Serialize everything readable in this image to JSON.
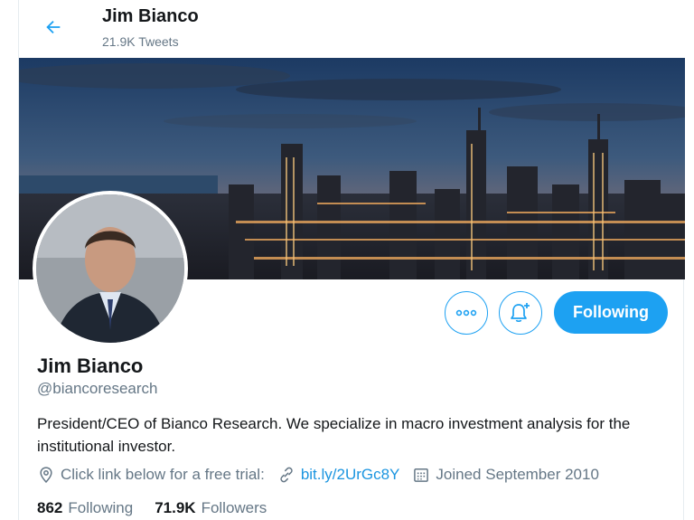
{
  "header": {
    "name": "Jim Bianco",
    "tweet_count": "21.9K Tweets"
  },
  "profile": {
    "display_name": "Jim Bianco",
    "handle": "@biancoresearch",
    "bio": "President/CEO of Bianco Research. We specialize in macro investment analysis for the institutional investor.",
    "location": "Click link below for a free trial:",
    "link": "bit.ly/2UrGc8Y",
    "joined": "Joined September 2010",
    "following_count": "862",
    "following_label": "Following",
    "followers_count": "71.9K",
    "followers_label": "Followers"
  },
  "actions": {
    "follow_label": "Following",
    "more_icon": "more-icon",
    "notify_icon": "bell-plus-icon"
  },
  "colors": {
    "accent": "#1da1f2",
    "link": "#1b95e0",
    "muted": "#657786"
  }
}
